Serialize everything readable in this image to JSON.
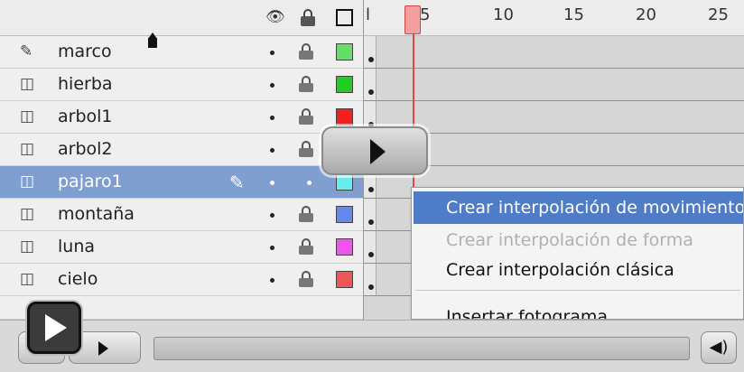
{
  "layer_header": {
    "visibility_icon": "eye-icon",
    "lock_icon": "lock-icon",
    "outline_icon": "outline-square-icon"
  },
  "layers": [
    {
      "name": "marco",
      "icon": "pen-tool-icon",
      "color": "#66dd66",
      "selected": false
    },
    {
      "name": "hierba",
      "icon": "layer-icon",
      "color": "#22cc22",
      "selected": false
    },
    {
      "name": "arbol1",
      "icon": "layer-icon",
      "color": "#ee2222",
      "selected": false
    },
    {
      "name": "arbol2",
      "icon": "layer-icon",
      "color": "#2244dd",
      "selected": false
    },
    {
      "name": "pajaro1",
      "icon": "layer-icon",
      "color": "#66eeee",
      "selected": true
    },
    {
      "name": "montaña",
      "icon": "layer-icon",
      "color": "#6688ee",
      "selected": false
    },
    {
      "name": "luna",
      "icon": "layer-icon",
      "color": "#ee55ee",
      "selected": false
    },
    {
      "name": "cielo",
      "icon": "layer-icon",
      "color": "#ee5555",
      "selected": false
    }
  ],
  "timeline": {
    "ruler_labels": [
      "l",
      "5",
      "10",
      "15",
      "20",
      "25"
    ],
    "current_frame": 5
  },
  "context_menu": {
    "items": [
      {
        "label": "Crear interpolación de movimiento",
        "state": "highlighted"
      },
      {
        "label": "Crear interpolación de forma",
        "state": "disabled"
      },
      {
        "label": "Crear interpolación clásica",
        "state": "normal"
      },
      {
        "label": "Insertar fotograma",
        "state": "normal"
      }
    ]
  },
  "controller": {
    "play_icon": "play-icon",
    "volume_icon": "volume-icon",
    "volume_glyph": "◀)",
    "progress": 0.0
  },
  "colors": {
    "selected_row": "#7f9fd1",
    "menu_highlight": "#4f7cc7",
    "playhead": "#e24848"
  }
}
